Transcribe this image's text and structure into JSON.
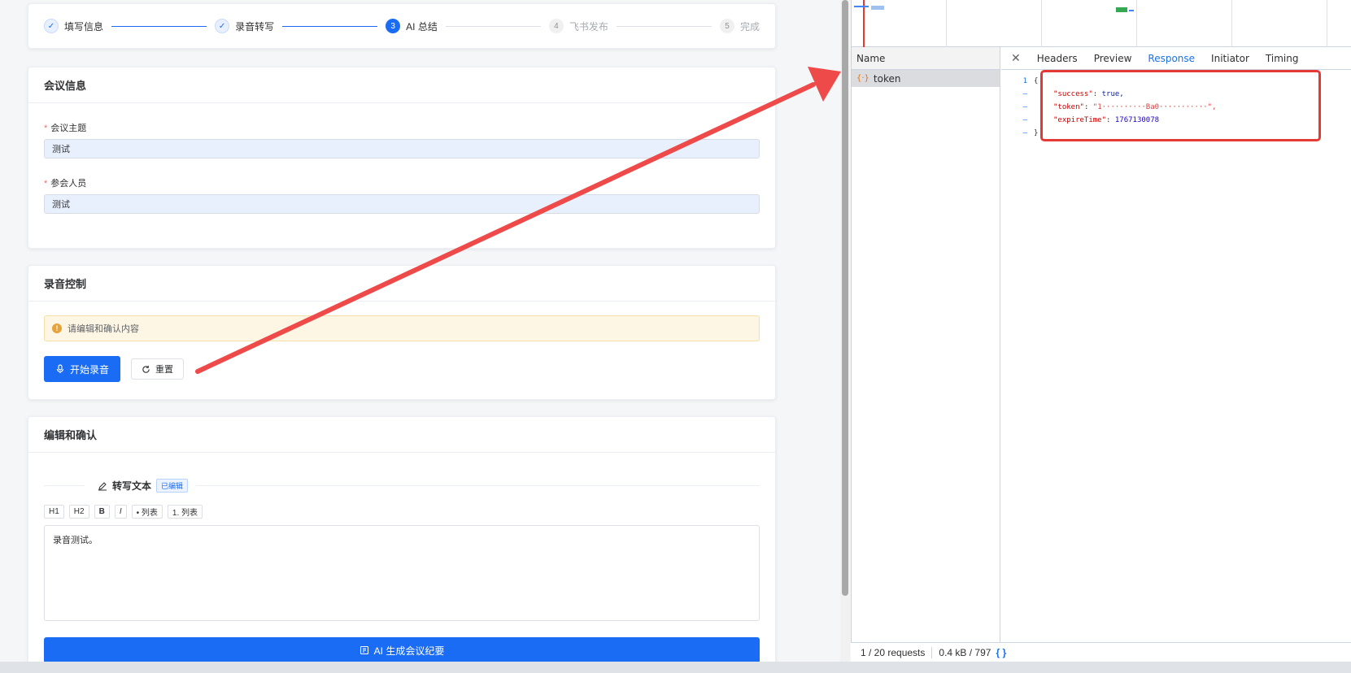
{
  "steps": [
    {
      "index": "✓",
      "label": "填写信息",
      "state": "done"
    },
    {
      "index": "✓",
      "label": "录音转写",
      "state": "done"
    },
    {
      "index": "3",
      "label": "AI 总结",
      "state": "active"
    },
    {
      "index": "4",
      "label": "飞书发布",
      "state": "wait"
    },
    {
      "index": "5",
      "label": "完成",
      "state": "wait"
    }
  ],
  "meeting": {
    "title": "会议信息",
    "topic_label": "会议主题",
    "topic_value": "测试",
    "participants_label": "参会人员",
    "participants_value": "测试"
  },
  "recording": {
    "title": "录音控制",
    "alert_text": "请编辑和确认内容",
    "start_label": "开始录音",
    "reset_label": "重置"
  },
  "edit": {
    "title": "编辑和确认",
    "section_title": "转写文本",
    "tag": "已编辑",
    "toolbar": [
      "H1",
      "H2",
      "B",
      "I",
      "• 列表",
      "1. 列表"
    ],
    "content": "录音测试。",
    "generate_label": "AI 生成会议纪要"
  },
  "devtools": {
    "name_header": "Name",
    "request_name": "token",
    "tabs": [
      "Headers",
      "Preview",
      "Response",
      "Initiator",
      "Timing"
    ],
    "active_tab": "Response",
    "response": {
      "open": "{",
      "success_key": "\"success\"",
      "success_val": "true,",
      "token_key": "\"token\"",
      "token_val": "\"1··········Ba0···········\",",
      "expire_key": "\"expireTime\"",
      "expire_val": "1767130078",
      "close": "}"
    },
    "status_requests": "1 / 20 requests",
    "status_size": "0.4 kB / 797",
    "format_icon": "{ }"
  },
  "colors": {
    "primary": "#1a6cf5",
    "annotation_red": "#e53935"
  }
}
